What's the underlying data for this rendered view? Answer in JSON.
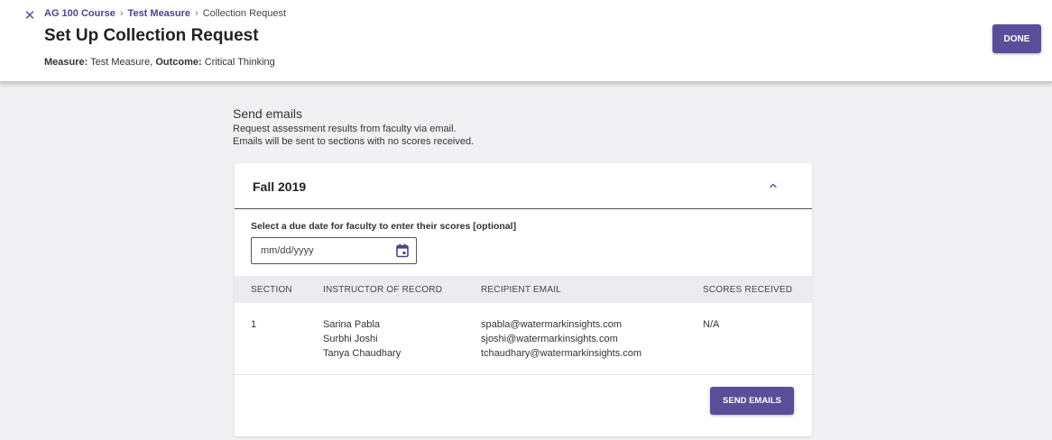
{
  "header": {
    "breadcrumb": {
      "course": "AG 100 Course",
      "measure": "Test Measure",
      "current": "Collection Request",
      "separator": "›"
    },
    "title": "Set Up Collection Request",
    "subtitle": {
      "measure_label": "Measure:",
      "measure_value": "Test Measure,",
      "outcome_label": "Outcome:",
      "outcome_value": "Critical Thinking"
    },
    "done_label": "DONE"
  },
  "send_section": {
    "title": "Send emails",
    "line1": "Request assessment results from faculty via email.",
    "line2": "Emails will be sent to sections with no scores received."
  },
  "card": {
    "term": "Fall 2019",
    "due_date_label": "Select a due date for faculty to enter their scores [optional]",
    "due_date_placeholder": "mm/dd/yyyy",
    "due_date_value": "",
    "columns": {
      "section": "SECTION",
      "instructor": "INSTRUCTOR OF RECORD",
      "email": "RECIPIENT EMAIL",
      "scores": "SCORES RECEIVED"
    },
    "rows": [
      {
        "section": "1",
        "instructors": [
          "Sarina Pabla",
          "Surbhi Joshi",
          "Tanya Chaudhary"
        ],
        "emails": [
          "spabla@watermarkinsights.com",
          "sjoshi@watermarkinsights.com",
          "tchaudhary@watermarkinsights.com"
        ],
        "scores": "N/A"
      }
    ],
    "send_label": "SEND EMAILS"
  },
  "icons": {
    "close": "close-icon",
    "collapse": "chevron-up-icon",
    "calendar": "calendar-icon"
  },
  "colors": {
    "accent": "#5a4e9a",
    "breadcrumb_link": "#4b4391",
    "table_header_bg": "#ebebf0",
    "page_bg": "#f1f1f3"
  }
}
